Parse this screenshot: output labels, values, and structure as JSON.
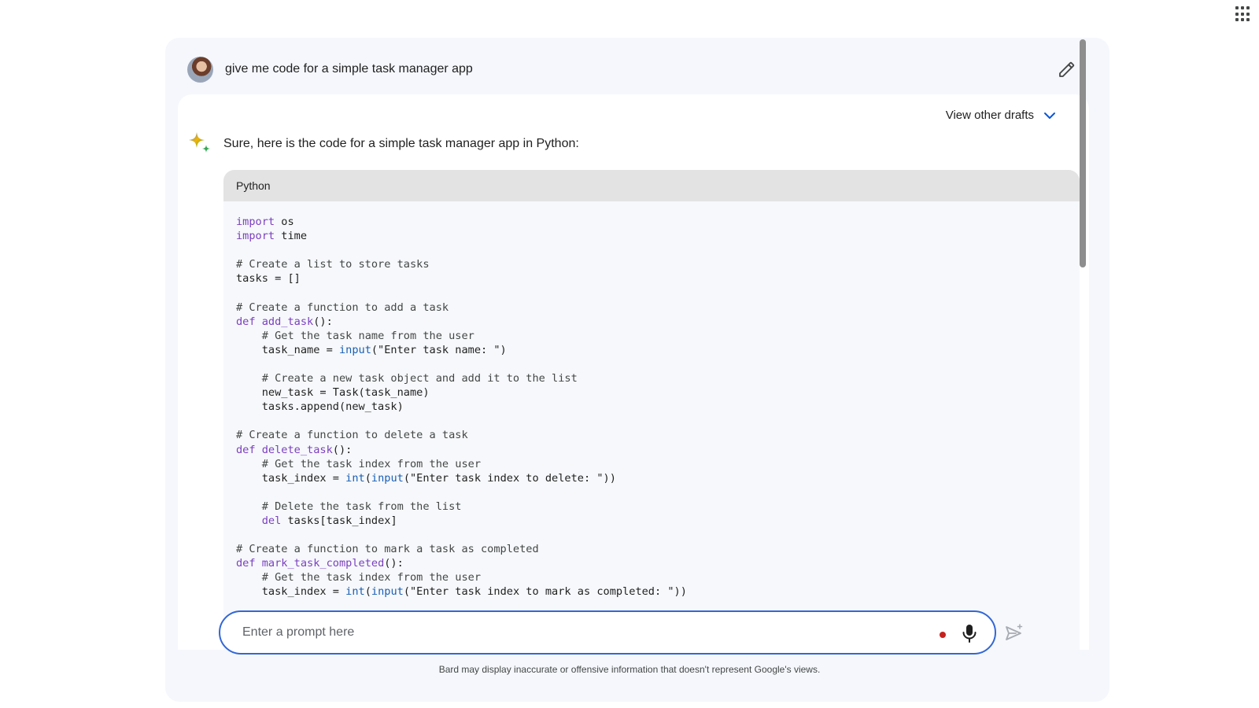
{
  "header": {
    "apps_icon": "apps-grid-icon"
  },
  "prompt": {
    "text": "give me code for a simple task manager app",
    "avatar_icon": "user-avatar",
    "edit_icon": "pencil-icon"
  },
  "response": {
    "drafts_label": "View other drafts",
    "drafts_icon": "chevron-down-icon",
    "sparkle_icon": "bard-sparkle-icon",
    "intro": "Sure, here is the code for a simple task manager app in Python:",
    "code": {
      "language": "Python",
      "lines": [
        "import os",
        "import time",
        "",
        "# Create a list to store tasks",
        "tasks = []",
        "",
        "# Create a function to add a task",
        "def add_task():",
        "    # Get the task name from the user",
        "    task_name = input(\"Enter task name: \")",
        "",
        "    # Create a new task object and add it to the list",
        "    new_task = Task(task_name)",
        "    tasks.append(new_task)",
        "",
        "# Create a function to delete a task",
        "def delete_task():",
        "    # Get the task index from the user",
        "    task_index = int(input(\"Enter task index to delete: \"))",
        "",
        "    # Delete the task from the list",
        "    del tasks[task_index]",
        "",
        "# Create a function to mark a task as completed",
        "def mark_task_completed():",
        "    # Get the task index from the user",
        "    task_index = int(input(\"Enter task index to mark as completed: \"))"
      ]
    }
  },
  "input": {
    "placeholder": "Enter a prompt here",
    "value": "",
    "mic_icon": "microphone-icon",
    "send_icon": "send-icon"
  },
  "footer": {
    "disclaimer": "Bard may display inaccurate or offensive information that doesn't represent Google's views."
  },
  "colors": {
    "accent": "#3367d6",
    "keyword": "#7b3fbf",
    "builtin": "#1a5fb4",
    "panel_bg": "#f5f7fc",
    "record_dot": "#c5221f"
  }
}
